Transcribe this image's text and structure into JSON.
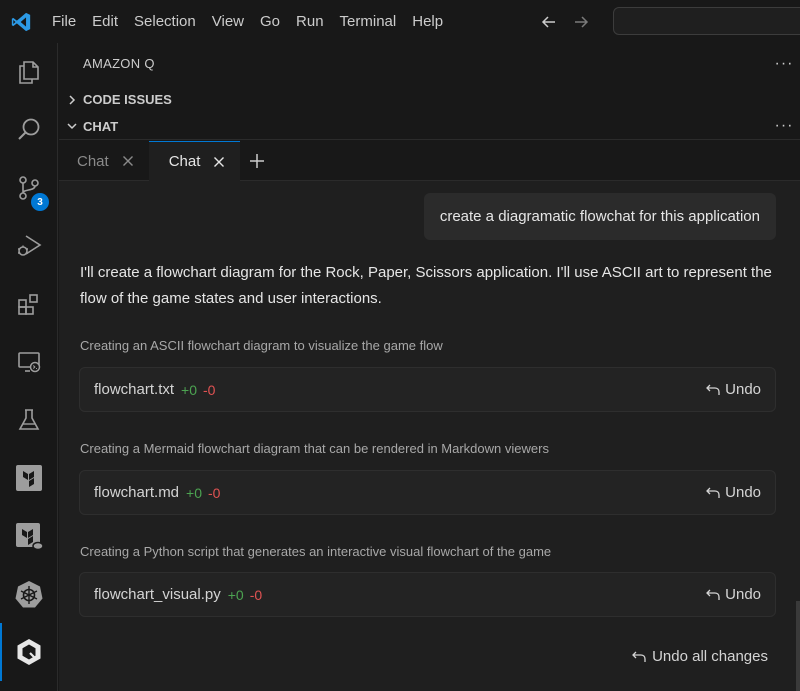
{
  "menu": [
    "File",
    "Edit",
    "Selection",
    "View",
    "Go",
    "Run",
    "Terminal",
    "Help"
  ],
  "colors": {
    "accent": "#0078d4",
    "added": "#4ca351",
    "removed": "#e05252"
  },
  "activity_bar": {
    "icons": [
      "explorer-icon",
      "search-icon",
      "source-control-icon",
      "run-debug-icon",
      "extensions-icon",
      "remote-explorer-icon",
      "testing-icon",
      "terraform-icon",
      "terraform-cloud-icon",
      "kubernetes-icon",
      "amazon-q-icon"
    ],
    "source_control_badge": "3"
  },
  "panel": {
    "title": "AMAZON Q",
    "sections": {
      "code_issues": "CODE ISSUES",
      "chat": "CHAT"
    }
  },
  "tabs": [
    {
      "label": "Chat",
      "active": false
    },
    {
      "label": "Chat",
      "active": true
    }
  ],
  "chat": {
    "user_message": "create a diagramatic flowchat for this application",
    "reply": "I'll create a flowchart diagram for the Rock, Paper, Scissors application. I'll use ASCII art to represent the flow of the game states and user interactions.",
    "changes": [
      {
        "caption": "Creating an ASCII flowchart diagram to visualize the game flow",
        "file": "flowchart.txt",
        "added": "+0",
        "removed": "-0",
        "undo_label": "Undo"
      },
      {
        "caption": "Creating a Mermaid flowchart diagram that can be rendered in Markdown viewers",
        "file": "flowchart.md",
        "added": "+0",
        "removed": "-0",
        "undo_label": "Undo"
      },
      {
        "caption": "Creating a Python script that generates an interactive visual flowchart of the game",
        "file": "flowchart_visual.py",
        "added": "+0",
        "removed": "-0",
        "undo_label": "Undo"
      }
    ],
    "undo_all_label": "Undo all changes"
  }
}
